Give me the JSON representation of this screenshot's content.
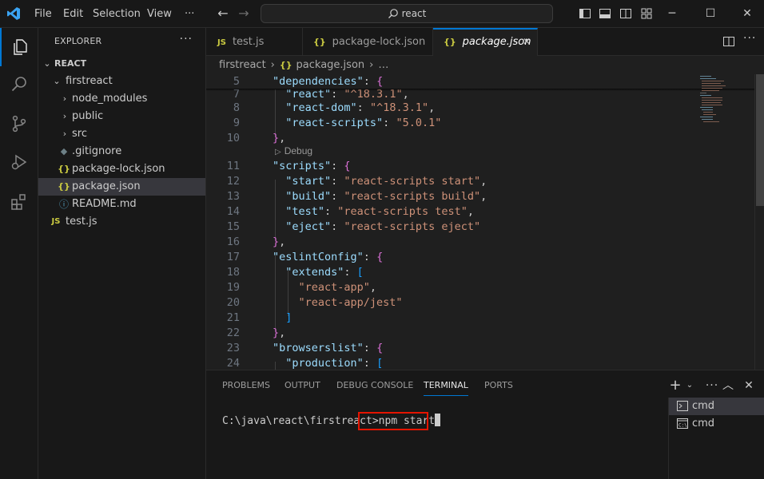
{
  "menu": [
    "File",
    "Edit",
    "Selection",
    "View",
    "···"
  ],
  "command_center": {
    "text": "react"
  },
  "sidebar": {
    "title": "EXPLORER",
    "more": "···",
    "root": "REACT",
    "items": [
      {
        "label": "firstreact",
        "kind": "folder-open",
        "icon": "chevron-down-icon"
      },
      {
        "label": "node_modules",
        "kind": "folder",
        "icon": "chevron-right-icon"
      },
      {
        "label": "public",
        "kind": "folder",
        "icon": "chevron-right-icon"
      },
      {
        "label": "src",
        "kind": "folder",
        "icon": "chevron-right-icon"
      },
      {
        "label": ".gitignore",
        "kind": "file",
        "icon": "git-diamond-icon"
      },
      {
        "label": "package-lock.json",
        "kind": "file",
        "icon": "json-braces-icon",
        "badge": "{}"
      },
      {
        "label": "package.json",
        "kind": "file",
        "icon": "json-braces-icon",
        "badge": "{}"
      },
      {
        "label": "README.md",
        "kind": "file",
        "icon": "info-icon",
        "badge": "ⓘ"
      },
      {
        "label": "test.js",
        "kind": "file",
        "icon": "js-icon",
        "badge": "JS"
      }
    ]
  },
  "tabs": [
    {
      "label": "test.js",
      "badge": "JS",
      "active": false
    },
    {
      "label": "package-lock.json",
      "badge": "{}",
      "active": false
    },
    {
      "label": "package.json",
      "badge": "{}",
      "active": true,
      "close": "✕"
    }
  ],
  "breadcrumb": {
    "folder": "firstreact",
    "file": "package.json",
    "tail": "…"
  },
  "code": {
    "codelens": "Debug",
    "lines": [
      {
        "n": "5",
        "t": "  \"dependencies\": {"
      },
      {
        "n": "7",
        "t": "    \"react\": \"^18.3.1\","
      },
      {
        "n": "8",
        "t": "    \"react-dom\": \"^18.3.1\","
      },
      {
        "n": "9",
        "t": "    \"react-scripts\": \"5.0.1\""
      },
      {
        "n": "10",
        "t": "  },"
      },
      {
        "n": "11",
        "t": "  \"scripts\": {"
      },
      {
        "n": "12",
        "t": "    \"start\": \"react-scripts start\","
      },
      {
        "n": "13",
        "t": "    \"build\": \"react-scripts build\","
      },
      {
        "n": "14",
        "t": "    \"test\": \"react-scripts test\","
      },
      {
        "n": "15",
        "t": "    \"eject\": \"react-scripts eject\""
      },
      {
        "n": "16",
        "t": "  },"
      },
      {
        "n": "17",
        "t": "  \"eslintConfig\": {"
      },
      {
        "n": "18",
        "t": "    \"extends\": ["
      },
      {
        "n": "19",
        "t": "      \"react-app\","
      },
      {
        "n": "20",
        "t": "      \"react-app/jest\""
      },
      {
        "n": "21",
        "t": "    ]"
      },
      {
        "n": "22",
        "t": "  },"
      },
      {
        "n": "23",
        "t": "  \"browserslist\": {"
      },
      {
        "n": "24",
        "t": "    \"production\": ["
      }
    ]
  },
  "panel": {
    "tabs": [
      "PROBLEMS",
      "OUTPUT",
      "DEBUG CONSOLE",
      "TERMINAL",
      "PORTS"
    ],
    "active_tab": "TERMINAL",
    "prompt": "C:\\java\\react\\firstreact>",
    "command": "npm start",
    "terminals": [
      {
        "label": "cmd",
        "icon": "terminal-icon",
        "selected": true
      },
      {
        "label": "cmd",
        "icon": "cmd-window-icon",
        "selected": false
      }
    ]
  },
  "colors": {
    "accent": "#0078d4",
    "highlight_box": "#e51400",
    "json_key": "#9cdcfe",
    "json_string": "#ce9178"
  }
}
